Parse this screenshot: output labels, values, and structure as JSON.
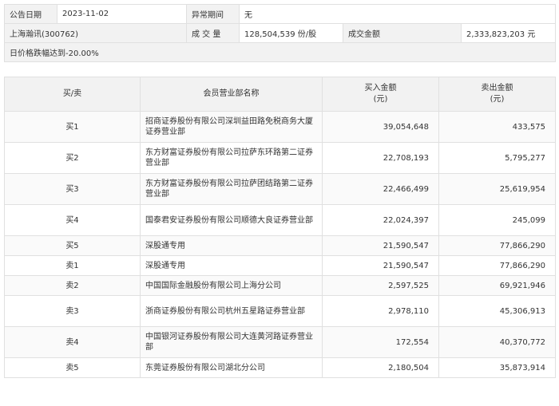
{
  "info": {
    "date_label": "公告日期",
    "date_value": "2023-11-02",
    "period_label": "异常期间",
    "period_value": "无",
    "stock_name": "上海瀚讯(300762)",
    "volume_label": "成 交 量",
    "volume_value": "128,504,539 份/股",
    "amount_label": "成交金额",
    "amount_value": "2,333,823,203 元",
    "note": "日价格跌幅达到-20.00%"
  },
  "table": {
    "headers": {
      "side": "买/卖",
      "dept": "会员营业部名称",
      "buy": "买入金额",
      "buy_unit": "(元)",
      "sell": "卖出金额",
      "sell_unit": "(元)"
    },
    "rows": [
      {
        "side": "买1",
        "name": "招商证券股份有限公司深圳益田路免税商务大厦证券营业部",
        "buy": "39,054,648",
        "sell": "433,575"
      },
      {
        "side": "买2",
        "name": "东方财富证券股份有限公司拉萨东环路第二证券营业部",
        "buy": "22,708,193",
        "sell": "5,795,277"
      },
      {
        "side": "买3",
        "name": "东方财富证券股份有限公司拉萨团结路第二证券营业部",
        "buy": "22,466,499",
        "sell": "25,619,954"
      },
      {
        "side": "买4",
        "name": "国泰君安证券股份有限公司顺德大良证券营业部",
        "buy": "22,024,397",
        "sell": "245,099"
      },
      {
        "side": "买5",
        "name": "深股通专用",
        "buy": "21,590,547",
        "sell": "77,866,290"
      },
      {
        "side": "卖1",
        "name": "深股通专用",
        "buy": "21,590,547",
        "sell": "77,866,290"
      },
      {
        "side": "卖2",
        "name": "中国国际金融股份有限公司上海分公司",
        "buy": "2,597,525",
        "sell": "69,921,946"
      },
      {
        "side": "卖3",
        "name": "浙商证券股份有限公司杭州五星路证券营业部",
        "buy": "2,978,110",
        "sell": "45,306,913"
      },
      {
        "side": "卖4",
        "name": "中国银河证券股份有限公司大连黄河路证券营业部",
        "buy": "172,554",
        "sell": "40,370,772"
      },
      {
        "side": "卖5",
        "name": "东莞证券股份有限公司湖北分公司",
        "buy": "2,180,504",
        "sell": "35,873,914"
      }
    ]
  }
}
